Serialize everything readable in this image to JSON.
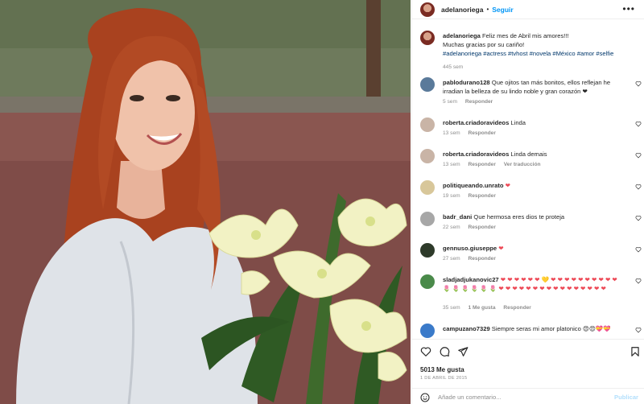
{
  "post": {
    "author": "adelanoriega",
    "follow_label": "Seguir",
    "caption_line1": "Feliz mes de Abril mis amores!!!",
    "caption_line2": "Muchas gracias por su cariño!",
    "caption_tags": "#adelanoriega #actress #tvhost #novela #México #amor #selfie",
    "caption_time": "445 sem"
  },
  "comments": [
    {
      "user": "pablodurano128",
      "text": "Que ojitos tan más bonitos, ellos reflejan he irradian la belleza de su lindo noble y gran corazón ❤",
      "time": "5 sem",
      "reply": "Responder",
      "avatar_color": "#5a7a9a"
    },
    {
      "user": "roberta.criadoravideos",
      "text": "Linda",
      "time": "13 sem",
      "reply": "Responder",
      "avatar_color": "#c9b4a6"
    },
    {
      "user": "roberta.criadoravideos",
      "text": "Linda demais",
      "time": "13 sem",
      "reply": "Responder",
      "translate": "Ver traducción",
      "avatar_color": "#c9b4a6"
    },
    {
      "user": "politiqueando.unrato",
      "text": "❤",
      "time": "19 sem",
      "reply": "Responder",
      "avatar_color": "#d8c79a"
    },
    {
      "user": "badr_dani",
      "text": "Que hermosa eres dios te proteja",
      "time": "22 sem",
      "reply": "Responder",
      "avatar_color": "#a7a7a7"
    },
    {
      "user": "gennuso.giuseppe",
      "text": "❤",
      "time": "27 sem",
      "reply": "Responder",
      "avatar_color": "#2e3a2a"
    },
    {
      "user": "sladjadjukanovic27",
      "text": "❤ ❤ ❤ ❤ ❤ ❤ 💛 ❤ ❤ ❤ ❤ ❤ ❤ ❤ ❤ ❤ ❤ 🌷 🌷 🌷 🌷 🌷 🌷 ❤ ❤ ❤ ❤ ❤ ❤ ❤ ❤ ❤ ❤ ❤ ❤ ❤ ❤ ❤ ❤",
      "time": "35 sem",
      "likes": "1 Me gusta",
      "reply": "Responder",
      "avatar_color": "#4a8a4a"
    },
    {
      "user": "campuzano7329",
      "text": "Siempre seras mi amor platonico 😍😍💝💝",
      "time": "",
      "reply": "",
      "avatar_color": "#3a7ac9"
    }
  ],
  "footer": {
    "likes": "5013 Me gusta",
    "date": "1 DE ABRIL DE 2015",
    "comment_placeholder": "Añade un comentario...",
    "publish_label": "Publicar"
  },
  "icons": {
    "more": "more-icon",
    "like": "heart-icon",
    "comment": "comment-icon",
    "share": "share-icon",
    "save": "bookmark-icon",
    "emoji": "smile-icon"
  },
  "colors": {
    "link_blue": "#0095f6",
    "tag_blue": "#00376b",
    "heart_red": "#ed4956",
    "muted": "#8e8e8e"
  }
}
